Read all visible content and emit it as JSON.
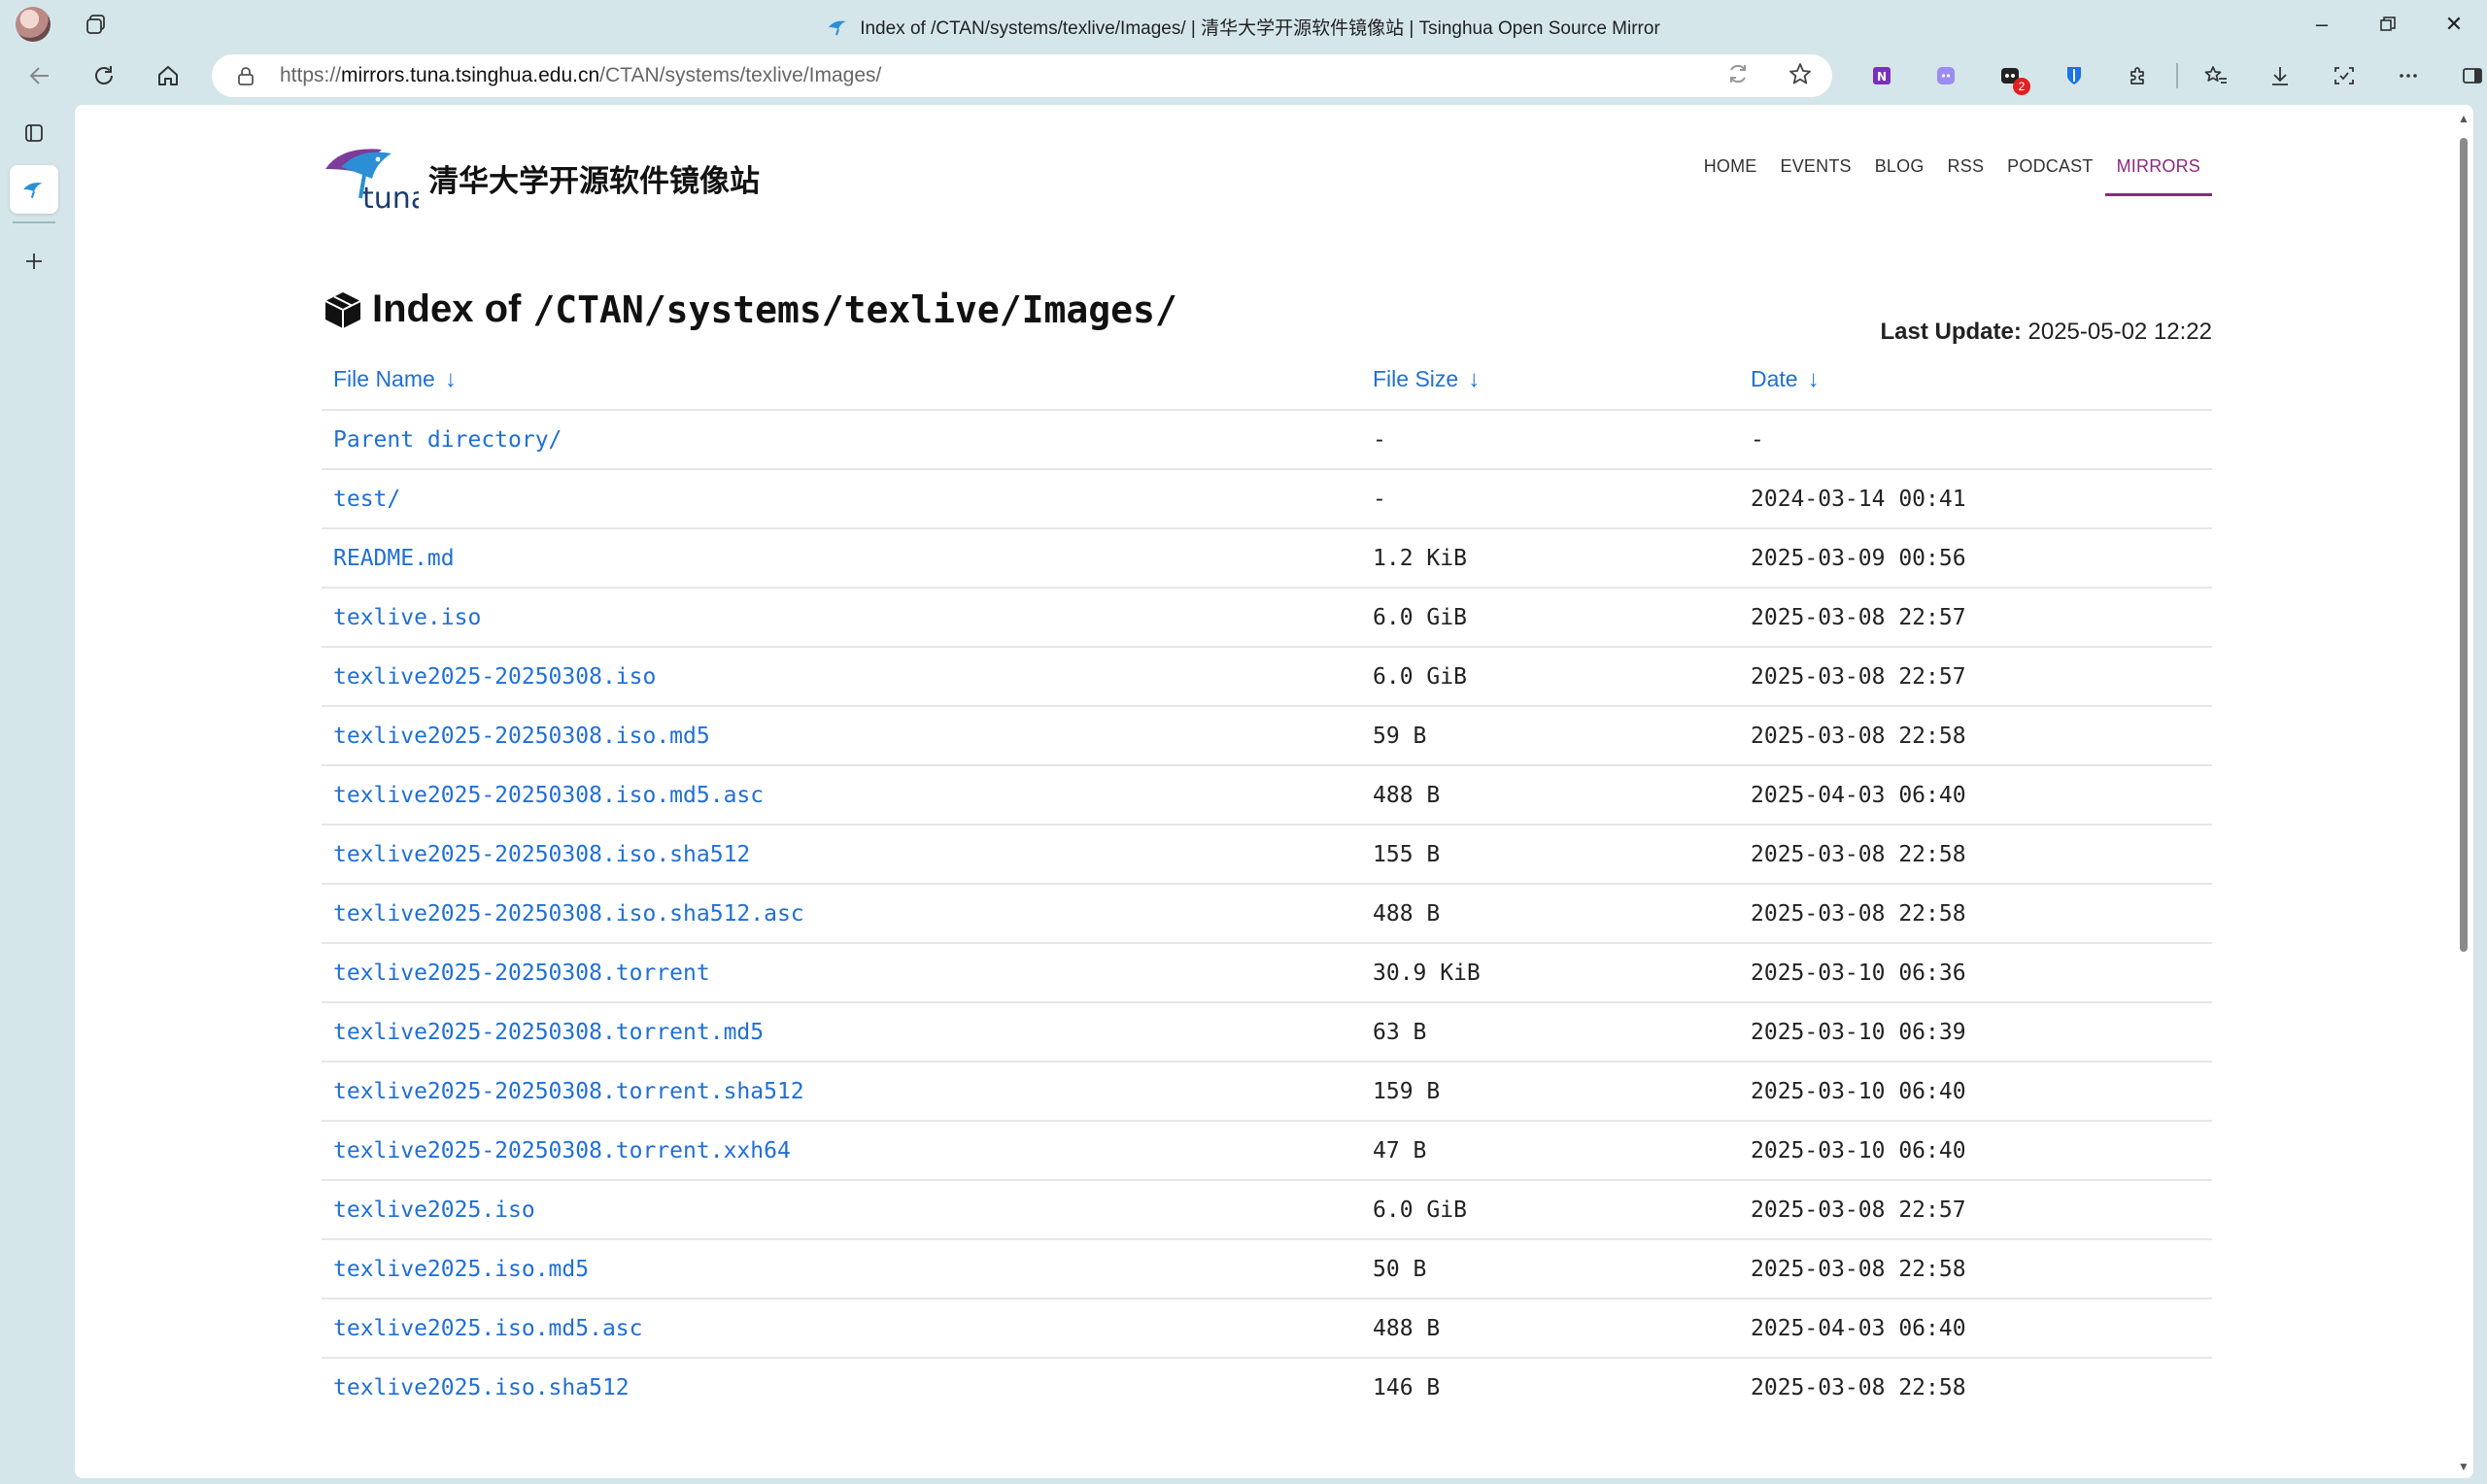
{
  "window": {
    "title": "Index of /CTAN/systems/texlive/Images/ | 清华大学开源软件镜像站 | Tsinghua Open Source Mirror"
  },
  "browser": {
    "url_scheme": "https://",
    "url_host": "mirrors.tuna.tsinghua.edu.cn",
    "url_path": "/CTAN/systems/texlive/Images/",
    "notification_badge": "2"
  },
  "site": {
    "logo_text": "清华大学开源软件镜像站",
    "nav": [
      {
        "label": "HOME"
      },
      {
        "label": "EVENTS"
      },
      {
        "label": "BLOG"
      },
      {
        "label": "RSS"
      },
      {
        "label": "PODCAST"
      },
      {
        "label": "MIRRORS"
      }
    ]
  },
  "index": {
    "title_prefix": "Index of",
    "path": "/CTAN/systems/texlive/Images/",
    "last_update_label": "Last Update:",
    "last_update_value": "2025-05-02 12:22"
  },
  "table": {
    "headers": [
      "File Name",
      "File Size",
      "Date"
    ],
    "sort_arrow": "↓",
    "rows": [
      {
        "name": "Parent directory/",
        "size": "-",
        "date": "-"
      },
      {
        "name": "test/",
        "size": "-",
        "date": "2024-03-14 00:41"
      },
      {
        "name": "README.md",
        "size": "1.2 KiB",
        "date": "2025-03-09 00:56"
      },
      {
        "name": "texlive.iso",
        "size": "6.0 GiB",
        "date": "2025-03-08 22:57"
      },
      {
        "name": "texlive2025-20250308.iso",
        "size": "6.0 GiB",
        "date": "2025-03-08 22:57"
      },
      {
        "name": "texlive2025-20250308.iso.md5",
        "size": "59 B",
        "date": "2025-03-08 22:58"
      },
      {
        "name": "texlive2025-20250308.iso.md5.asc",
        "size": "488 B",
        "date": "2025-04-03 06:40"
      },
      {
        "name": "texlive2025-20250308.iso.sha512",
        "size": "155 B",
        "date": "2025-03-08 22:58"
      },
      {
        "name": "texlive2025-20250308.iso.sha512.asc",
        "size": "488 B",
        "date": "2025-03-08 22:58"
      },
      {
        "name": "texlive2025-20250308.torrent",
        "size": "30.9 KiB",
        "date": "2025-03-10 06:36"
      },
      {
        "name": "texlive2025-20250308.torrent.md5",
        "size": "63 B",
        "date": "2025-03-10 06:39"
      },
      {
        "name": "texlive2025-20250308.torrent.sha512",
        "size": "159 B",
        "date": "2025-03-10 06:40"
      },
      {
        "name": "texlive2025-20250308.torrent.xxh64",
        "size": "47 B",
        "date": "2025-03-10 06:40"
      },
      {
        "name": "texlive2025.iso",
        "size": "6.0 GiB",
        "date": "2025-03-08 22:57"
      },
      {
        "name": "texlive2025.iso.md5",
        "size": "50 B",
        "date": "2025-03-08 22:58"
      },
      {
        "name": "texlive2025.iso.md5.asc",
        "size": "488 B",
        "date": "2025-04-03 06:40"
      },
      {
        "name": "texlive2025.iso.sha512",
        "size": "146 B",
        "date": "2025-03-08 22:58"
      }
    ]
  },
  "colors": {
    "link": "#1f6fd6",
    "active_nav": "#8a2a84",
    "chrome_bg": "#d4e6ea"
  }
}
